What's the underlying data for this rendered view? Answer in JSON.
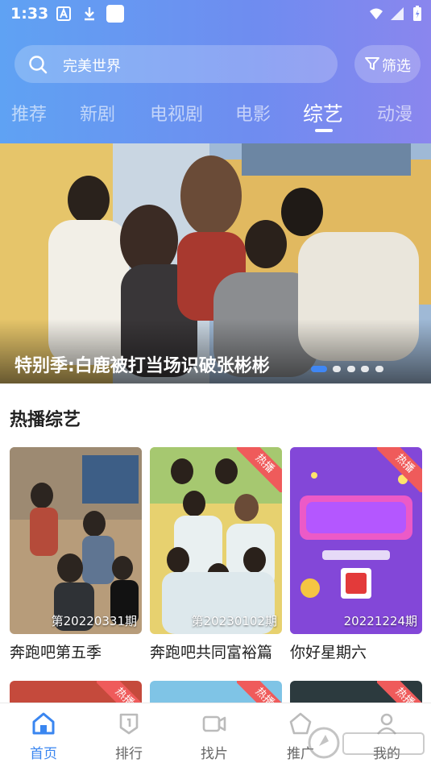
{
  "status_bar": {
    "time": "1:33"
  },
  "search": {
    "placeholder": "完美世界",
    "filter_label": "筛选"
  },
  "tabs": [
    {
      "label": "推荐",
      "active": false
    },
    {
      "label": "新剧",
      "active": false
    },
    {
      "label": "电视剧",
      "active": false
    },
    {
      "label": "电影",
      "active": false
    },
    {
      "label": "综艺",
      "active": true
    },
    {
      "label": "动漫",
      "active": false
    }
  ],
  "banner": {
    "title": "特别季:白鹿被打当场识破张彬彬",
    "slides": 5,
    "active_slide": 1
  },
  "section": {
    "title": "热播综艺"
  },
  "cards": [
    {
      "title": "奔跑吧第五季",
      "episode": "第20220331期",
      "badge": ""
    },
    {
      "title": "奔跑吧共同富裕篇",
      "episode": "第20230102期",
      "badge": "热播"
    },
    {
      "title": "你好星期六",
      "episode": "20221224期",
      "badge": "热播"
    }
  ],
  "row2_badges": [
    "热播",
    "热播",
    "热播"
  ],
  "bottom_nav": [
    {
      "label": "首页",
      "icon": "home-icon",
      "active": true
    },
    {
      "label": "排行",
      "icon": "rank-icon",
      "active": false
    },
    {
      "label": "找片",
      "icon": "video-icon",
      "active": false
    },
    {
      "label": "推广",
      "icon": "promote-icon",
      "active": false
    },
    {
      "label": "我的",
      "icon": "user-icon",
      "active": false
    }
  ],
  "colors": {
    "accent": "#3a86f0",
    "badge": "#ef5b5b",
    "header_start": "#5fa2f3",
    "header_end": "#8a86ee"
  }
}
